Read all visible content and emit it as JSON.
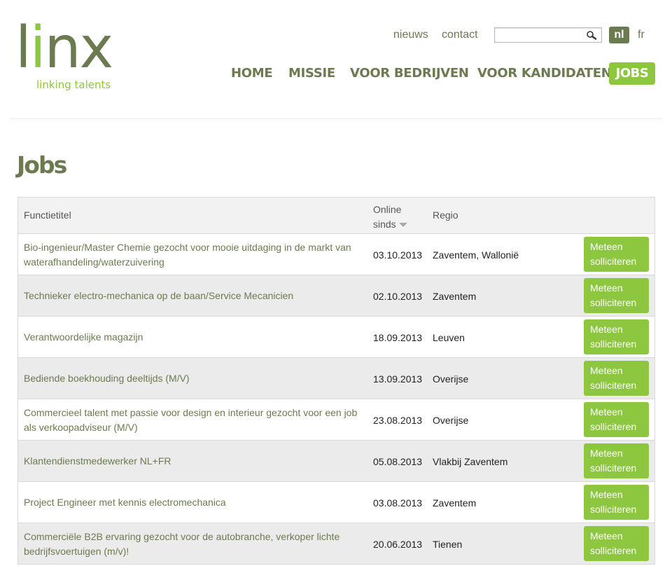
{
  "logo": {
    "word_l": "l",
    "word_i": "i",
    "word_nx": "nx",
    "tagline": "linking talents"
  },
  "topnav": {
    "news": "nieuws",
    "contact": "contact"
  },
  "search": {
    "value": "",
    "placeholder": "",
    "icon": "magnifier-icon"
  },
  "languages": {
    "active": "nl",
    "other": "fr"
  },
  "mainnav": {
    "home": "HOME",
    "missie": "MISSIE",
    "bedrijven": "VOOR BEDRIJVEN",
    "kandidaten": "VOOR KANDIDATEN",
    "jobs": "JOBS"
  },
  "page": {
    "title": "Jobs"
  },
  "table": {
    "headers": {
      "title": "Functietitel",
      "online_1": "Online",
      "online_2": "sinds",
      "regio": "Regio"
    },
    "apply_line1": "Meteen",
    "apply_line2": "solliciteren",
    "rows": [
      {
        "title": "Bio-ingenieur/Master Chemie gezocht voor mooie uitdaging in de markt van waterafhandeling/waterzuivering",
        "date": "03.10.2013",
        "regio": "Zaventem, Wallonië"
      },
      {
        "title": "Technieker electro-mechanica op de baan/Service Mecanicien",
        "date": "02.10.2013",
        "regio": "Zaventem"
      },
      {
        "title": "Verantwoordelijke magazijn",
        "date": "18.09.2013",
        "regio": "Leuven"
      },
      {
        "title": "Bediende boekhouding deeltijds (M/V)",
        "date": "13.09.2013",
        "regio": "Overijse"
      },
      {
        "title": "Commercieel talent met passie voor design en interieur gezocht voor een job als verkoopadviseur (M/V)",
        "date": "23.08.2013",
        "regio": "Overijse"
      },
      {
        "title": "Klantendienstmedewerker NL+FR",
        "date": "05.08.2013",
        "regio": "Vlakbij Zaventem"
      },
      {
        "title": "Project Engineer met kennis electromechanica",
        "date": "03.08.2013",
        "regio": "Zaventem"
      },
      {
        "title": "Commerciële B2B ervaring gezocht voor de autobranche, verkoper lichte bedrijfsvoertuigen (m/v)!",
        "date": "20.06.2013",
        "regio": "Tienen"
      }
    ]
  },
  "colors": {
    "brand_olive": "#6b7a4f",
    "brand_green": "#8dc63f",
    "row_alt": "#ebebeb"
  }
}
